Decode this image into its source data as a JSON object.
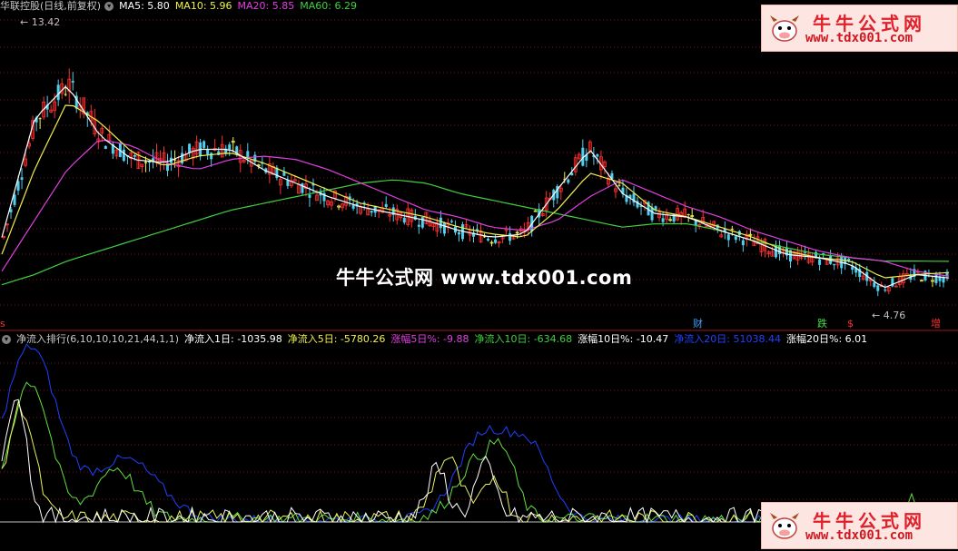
{
  "header_top": {
    "title": "华联控股(日线,前复权)",
    "ma5": "MA5: 5.80",
    "ma10": "MA10: 5.96",
    "ma20": "MA20: 5.85",
    "ma60": "MA60: 6.29"
  },
  "header_bottom": {
    "indicator": "净流入排行(6,10,10,10,21,44,1,1)",
    "v1": "净流入1日: -1035.98",
    "v2": "净流入5日: -5780.26",
    "v3": "涨幅5日%: -9.88",
    "v4": "净流入10日: -634.68",
    "v5": "涨幅10日%: -10.47",
    "v6": "净流入20日: 51038.44",
    "v7": "涨幅20日%: 6.01"
  },
  "price_labels": {
    "high": "13.42",
    "low": "4.76"
  },
  "markers": {
    "m1": "财",
    "m2": "跌",
    "m3": "$",
    "m4": "增",
    "left_red": "s"
  },
  "watermark": {
    "main": "牛牛公式网 www.tdx001.com"
  },
  "logo": {
    "line1": "牛牛公式网",
    "line2": "www.tdx001.com"
  },
  "colors": {
    "ma5": "#ffffff",
    "ma10": "#f0f050",
    "ma20": "#e040e0",
    "ma60": "#40d040",
    "up": "#ff3030",
    "down": "#50d0f0",
    "flat": "#f0f050",
    "grid": "#801010",
    "ind_white": "#ffffff",
    "ind_yellow": "#e8f060",
    "ind_green": "#60e040",
    "ind_blue": "#2040ff"
  },
  "chart_data": {
    "type": "line",
    "title": "华联控股(日线,前复权)",
    "series": [
      {
        "name": "MA60",
        "values": [
          5.6,
          5.9,
          6.3,
          6.6,
          6.9,
          7.2,
          7.5,
          7.8,
          8.0,
          8.2,
          8.4,
          8.6,
          8.7,
          8.6,
          8.3,
          8.1,
          7.9,
          7.7,
          7.5,
          7.3,
          7.4,
          7.4,
          7.2,
          6.9,
          6.7,
          6.5,
          6.4,
          6.3,
          6.3,
          6.29
        ]
      },
      {
        "name": "MA20",
        "values": [
          6.0,
          7.5,
          9.0,
          9.9,
          9.7,
          9.2,
          9.0,
          9.3,
          9.4,
          9.3,
          9.0,
          8.6,
          8.2,
          7.8,
          7.6,
          7.3,
          7.2,
          7.5,
          8.2,
          8.7,
          8.3,
          7.9,
          7.6,
          7.2,
          6.9,
          6.6,
          6.4,
          6.3,
          6.0,
          5.85
        ]
      },
      {
        "name": "MA10",
        "values": [
          6.5,
          9.0,
          11.0,
          10.4,
          9.5,
          9.1,
          9.4,
          9.5,
          9.2,
          8.8,
          8.4,
          8.0,
          7.8,
          7.6,
          7.3,
          7.1,
          7.0,
          7.8,
          8.9,
          8.6,
          7.8,
          7.6,
          7.3,
          7.0,
          6.6,
          6.4,
          6.3,
          5.8,
          5.9,
          5.96
        ]
      },
      {
        "name": "MA5",
        "values": [
          7.0,
          10.5,
          11.5,
          10.0,
          9.3,
          9.2,
          9.6,
          9.6,
          9.0,
          8.6,
          8.2,
          7.9,
          7.7,
          7.5,
          7.2,
          7.0,
          7.1,
          8.4,
          9.6,
          8.3,
          7.7,
          7.6,
          7.2,
          6.9,
          6.5,
          6.4,
          6.2,
          5.5,
          5.9,
          5.8
        ]
      }
    ],
    "ylim": [
      4.76,
      13.42
    ]
  }
}
